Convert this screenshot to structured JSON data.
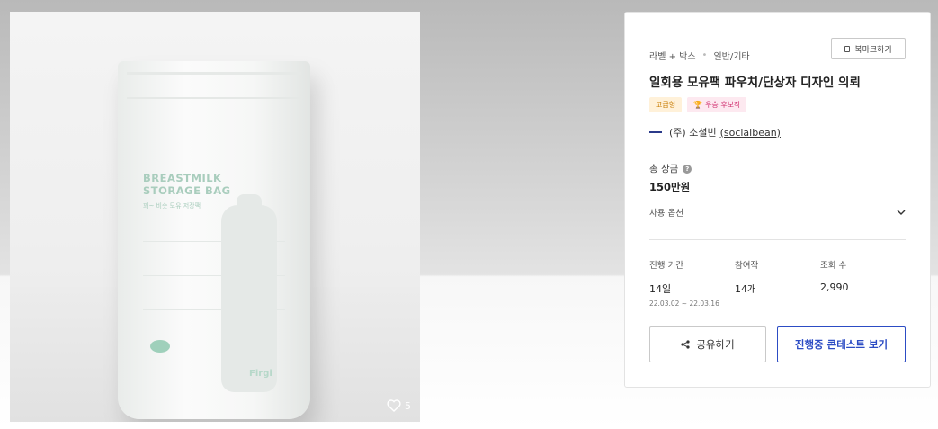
{
  "gallery": {
    "like_count": "5",
    "package_text": {
      "title_line1": "BREASTMILK",
      "title_line2": "STORAGE BAG",
      "subtitle": "꽤~ 비슷 모유 저장팩",
      "brand": "Firgi"
    }
  },
  "info": {
    "breadcrumb": [
      "라벨 + 박스",
      "일반/기타"
    ],
    "bookmark_label": "북마크하기",
    "title": "일회용 모유팩 파우치/단상자 디자인 의뢰",
    "badges": {
      "grade": "고급형",
      "award": "우승 후보작"
    },
    "company": {
      "name": "(주) 소셜빈",
      "link": "(socialbean)"
    },
    "prize": {
      "label": "총 상금",
      "value": "150만원"
    },
    "usage_option_label": "사용 옵션",
    "stats": {
      "period_label": "진행 기간",
      "period_value": "14일",
      "period_dates": "22.03.02 ~ 22.03.16",
      "entries_label": "참여작",
      "entries_value": "14개",
      "views_label": "조회 수",
      "views_value": "2,990"
    },
    "share_label": "공유하기",
    "contest_label": "진행중 콘테스트 보기"
  },
  "colors": {
    "accent": "#2c4cc4",
    "grade_badge": "#c77b00",
    "award_badge": "#d02c6d"
  }
}
